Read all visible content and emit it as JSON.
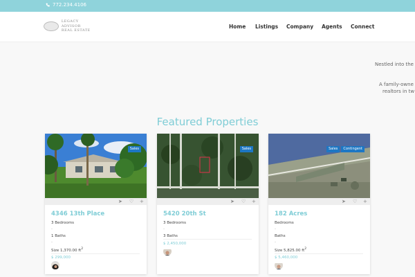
{
  "topbar": {
    "phone_icon": "phone-icon",
    "phone": "772.234.4106"
  },
  "brand": {
    "logo_line1": "LEGACY ADVISOR",
    "logo_line2": "REAL ESTATE"
  },
  "nav": [
    {
      "label": "Home"
    },
    {
      "label": "Listings"
    },
    {
      "label": "Company"
    },
    {
      "label": "Agents"
    },
    {
      "label": "Connect"
    }
  ],
  "hero": {
    "line1": "Nestled into the",
    "line2": "A family-owne",
    "line3": "realtors in tw"
  },
  "section": {
    "title": "Featured Properties"
  },
  "listings": [
    {
      "title": "4346 13th Place",
      "bedrooms": "3 Bedrooms",
      "baths": "1 Baths",
      "size_label": "Size 1,370.00 ft",
      "sup": "2",
      "price": "$ 299,000",
      "badges": [
        "Sales"
      ],
      "actions": [
        "share-icon",
        "heart-icon",
        "plus-icon"
      ]
    },
    {
      "title": "5420 20th St",
      "bedrooms": "3 Bedrooms",
      "baths": "3 Baths",
      "price": "$ 2,450,000",
      "badges": [
        "Sales"
      ],
      "actions": [
        "share-icon",
        "heart-icon",
        "plus-icon"
      ]
    },
    {
      "title": "182 Acres",
      "bedrooms": "Bedrooms",
      "baths": "Baths",
      "size_label": "Size 5,825.00 ft",
      "sup": "2",
      "price": "$ 5,460,000",
      "badges": [
        "Sales",
        "Contingent"
      ],
      "actions": [
        "share-icon",
        "heart-icon",
        "plus-icon"
      ]
    }
  ],
  "colors": {
    "accent": "#7fcdd6",
    "topbar": "#8fd3db",
    "badge": "#1d77c4"
  }
}
